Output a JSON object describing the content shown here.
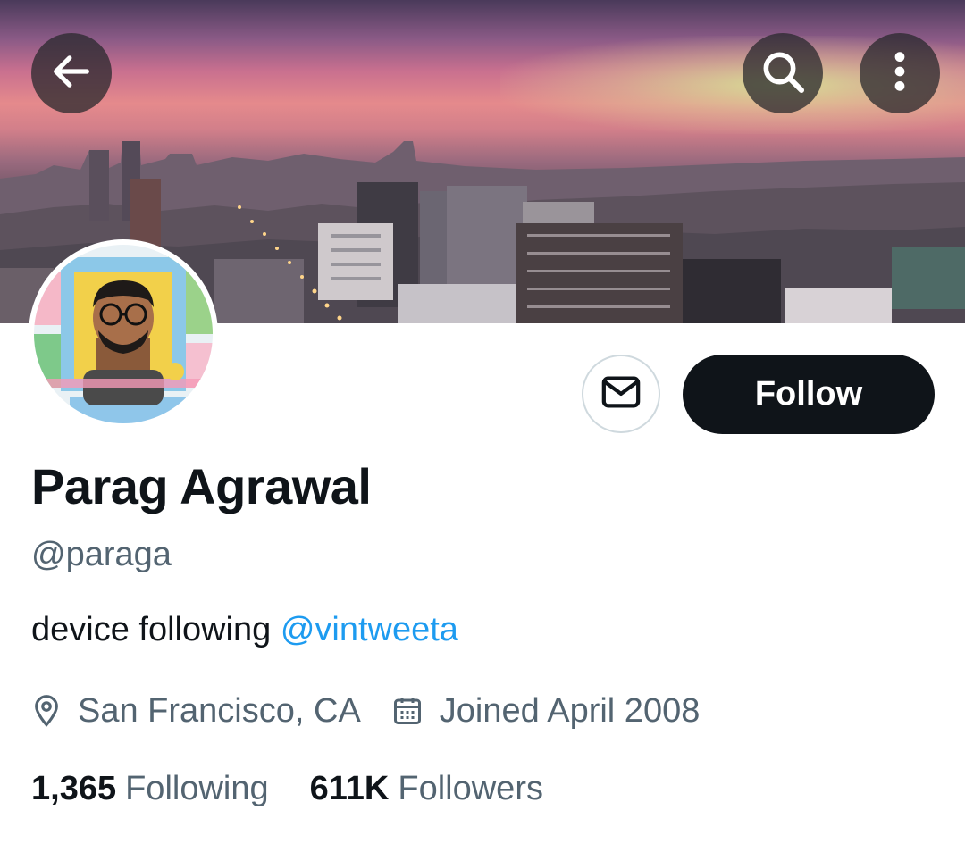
{
  "header": {
    "back_icon": "arrow-left-icon",
    "search_icon": "search-icon",
    "more_icon": "more-vertical-icon"
  },
  "profile": {
    "name": "Parag Agrawal",
    "handle": "@paraga",
    "bio_text": "device following ",
    "bio_mention": "@vintweeta",
    "location": "San Francisco, CA",
    "joined": "Joined April 2008",
    "following_count": "1,365",
    "following_label": "Following",
    "followers_count": "611K",
    "followers_label": "Followers"
  },
  "actions": {
    "message_icon": "envelope-icon",
    "follow_label": "Follow"
  },
  "colors": {
    "text_primary": "#0f1419",
    "text_secondary": "#536471",
    "link": "#1d9bf0",
    "follow_bg": "#0f1419"
  }
}
